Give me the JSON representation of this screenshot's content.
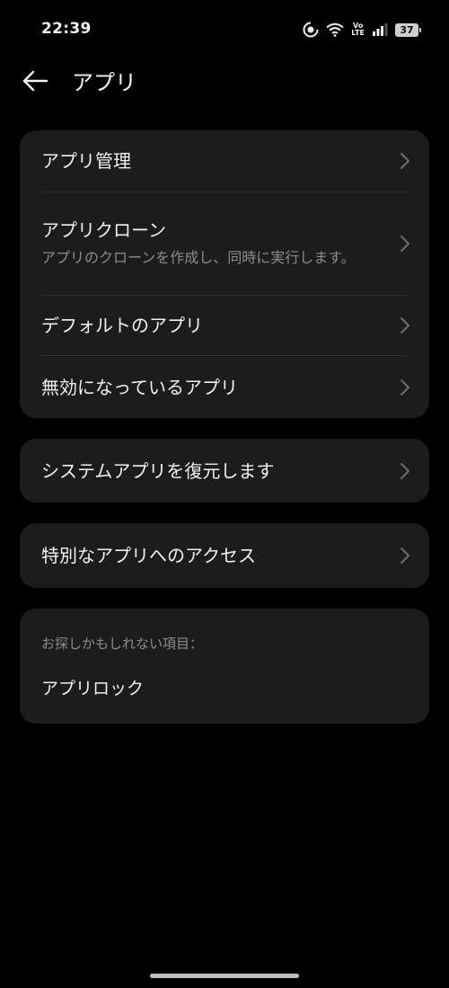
{
  "status_bar": {
    "time": "22:39",
    "battery": "37",
    "volte_top": "Vo",
    "volte_bottom": "LTE",
    "icons": [
      "data-saver-icon",
      "wifi-icon",
      "volte-icon",
      "signal-icon",
      "battery-icon"
    ]
  },
  "header": {
    "title": "アプリ",
    "back_icon": "arrow-left-icon"
  },
  "cards": {
    "main": {
      "items": [
        {
          "label": "アプリ管理"
        },
        {
          "label": "アプリクローン",
          "sub": "アプリのクローンを作成し、同時に実行します。"
        },
        {
          "label": "デフォルトのアプリ"
        },
        {
          "label": "無効になっているアプリ"
        }
      ]
    },
    "restore": {
      "label": "システムアプリを復元します"
    },
    "special": {
      "label": "特別なアプリへのアクセス"
    },
    "suggest": {
      "hint": "お探しかもしれない項目：",
      "item": "アプリロック"
    }
  },
  "colors": {
    "background": "#000000",
    "card": "#1c1c1e",
    "text": "#f0f0f0",
    "subtext": "#8c8c8c",
    "chevron": "#6e6e6e"
  }
}
